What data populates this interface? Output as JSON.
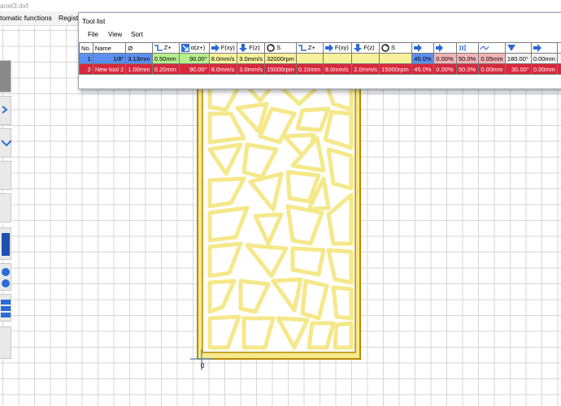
{
  "app": {
    "title": "anel3.dxf",
    "menu": [
      "tomatic functions",
      "Registe"
    ]
  },
  "tool_window": {
    "title": "Tool list",
    "menu": [
      "File",
      "View",
      "Sort"
    ],
    "columns": [
      "No.",
      "Name",
      "Ø",
      "Z+",
      "α(z+)",
      "F(xy)",
      "F(z)",
      "S",
      "Z+",
      "F(xy)",
      "F(z)",
      "S",
      "",
      "",
      "",
      "",
      "",
      "",
      ""
    ],
    "column_icons": [
      "",
      "",
      "",
      "step-down-icon",
      "arrow-diagonal-icon",
      "arrow-right-icon",
      "arrow-down-icon",
      "spindle-icon",
      "step-down-icon",
      "arrow-right-icon",
      "arrow-down-icon",
      "spindle-icon",
      "arrow-right-icon",
      "arc-arrow-icon",
      "wave-up-icon",
      "wave-icon",
      "angle-down-icon",
      "arrow-right-icon",
      ""
    ],
    "rows": [
      {
        "cells": [
          "1",
          "1/8\"",
          "3.13mm",
          "0.50mm",
          "90.00°",
          "8.0mm/s",
          "3.0mm/s",
          "32000rpm",
          "",
          "",
          "",
          "",
          "45.0%",
          "0.00%",
          "50.0%",
          "0.05mm",
          "180.00°",
          "0.00mm",
          ""
        ]
      },
      {
        "cells": [
          "2",
          "New tool 2",
          "1.00mm",
          "0.20mm",
          "90.00°",
          "8.0mm/s",
          "3.0mm/s",
          "15000rpm",
          "0.10mm",
          "8.0mm/s",
          "2.0mm/s",
          "15000rpm",
          "45.0%",
          "0.00%",
          "50.0%",
          "0.00mm",
          "30.00°",
          "0.00mm",
          ""
        ]
      }
    ]
  },
  "canvas": {
    "origin_label": "0"
  },
  "colors": {
    "panel_fill": "#f5e88a",
    "panel_stroke": "#b88a00",
    "selected_row": "#d8283c",
    "row1_name": "#5b8ff0"
  }
}
